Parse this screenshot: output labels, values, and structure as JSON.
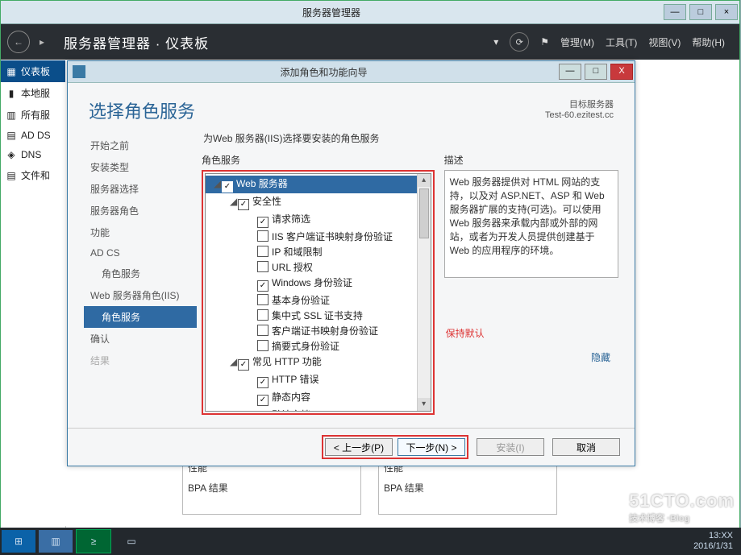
{
  "outer": {
    "title": "服务器管理器",
    "breadcrumb": "服务器管理器 · 仪表板",
    "menu": {
      "manage": "管理(M)",
      "tools": "工具(T)",
      "view": "视图(V)",
      "help": "帮助(H)"
    }
  },
  "sidebar": [
    "仪表板",
    "本地服",
    "所有服",
    "AD DS",
    "DNS",
    "文件和"
  ],
  "bpa": {
    "perf": "性能",
    "bpa": "BPA 结果"
  },
  "watermark": {
    "l1": "51CTO.com",
    "l2": "技术博客  ·Blog"
  },
  "clock": {
    "time": "13:XX",
    "date": "2016/1/31"
  },
  "wizard": {
    "title": "添加角色和功能向导",
    "heading": "选择角色服务",
    "target_label": "目标服务器",
    "target_value": "Test-60.ezitest.cc",
    "instruction": "为Web 服务器(IIS)选择要安装的角色服务",
    "nav": [
      "开始之前",
      "安装类型",
      "服务器选择",
      "服务器角色",
      "功能",
      "AD CS",
      "角色服务",
      "Web 服务器角色(IIS)",
      "角色服务",
      "确认",
      "结果"
    ],
    "col_roles": "角色服务",
    "col_desc": "描述",
    "desc_text": "Web 服务器提供对 HTML 网站的支持，以及对 ASP.NET、ASP 和 Web 服务器扩展的支持(可选)。可以使用 Web 服务器来承载内部或外部的网站，或者为开发人员提供创建基于 Web 的应用程序的环境。",
    "hide": "隐藏",
    "keep": "保持默认",
    "tree": [
      {
        "d": 0,
        "exp": "▢",
        "cb": true,
        "label": "Web 服务器",
        "hl": true
      },
      {
        "d": 1,
        "exp": "▢",
        "cb": true,
        "label": "安全性"
      },
      {
        "d": 2,
        "cb": true,
        "label": "请求筛选"
      },
      {
        "d": 2,
        "cb": false,
        "label": "IIS 客户端证书映射身份验证"
      },
      {
        "d": 2,
        "cb": false,
        "label": "IP 和域限制"
      },
      {
        "d": 2,
        "cb": false,
        "label": "URL 授权"
      },
      {
        "d": 2,
        "cb": true,
        "label": "Windows 身份验证"
      },
      {
        "d": 2,
        "cb": false,
        "label": "基本身份验证"
      },
      {
        "d": 2,
        "cb": false,
        "label": "集中式 SSL 证书支持"
      },
      {
        "d": 2,
        "cb": false,
        "label": "客户端证书映射身份验证"
      },
      {
        "d": 2,
        "cb": false,
        "label": "摘要式身份验证"
      },
      {
        "d": 1,
        "exp": "▢",
        "cb": true,
        "label": "常见 HTTP 功能"
      },
      {
        "d": 2,
        "cb": true,
        "label": "HTTP 错误"
      },
      {
        "d": 2,
        "cb": true,
        "label": "静态内容"
      },
      {
        "d": 2,
        "cb": true,
        "label": "默认文档"
      }
    ],
    "buttons": {
      "prev": "< 上一步(P)",
      "next": "下一步(N) >",
      "install": "安装(I)",
      "cancel": "取消"
    }
  }
}
